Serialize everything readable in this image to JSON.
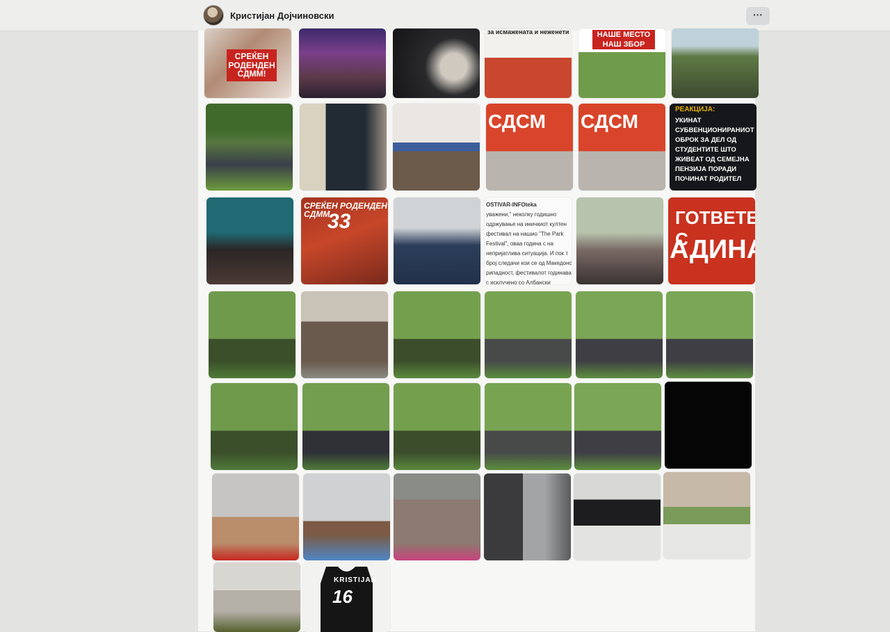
{
  "header": {
    "profile_name": "Кристијан Дојчиновски",
    "more_label": "···"
  },
  "overlays": {
    "birthday": "СРЕЌЕН РОДЕНДЕН СДММ!",
    "headline_top": "за исмажената и неженети",
    "nashe_mesto": "НАШЕ МЕСТО НАШ ЗБОР",
    "reaction_title": "РЕАКЦИЈА:",
    "reaction_text": "УКИНАТ СУБВЕНЦИОНИРАНИОТ ОБРОК ЗА ДЕЛ ОД СТУДЕНТИТЕ ШТО ЖИВЕАТ ОД СЕМЕЈНА ПЕНЗИЈА ПОРАДИ ПОЧИНАТ РОДИТЕЛ",
    "sdsm_wall": "СДСМ",
    "birthday33_a": "СРЕЌЕН РОДЕНДЕН СДММ",
    "birthday33_num": "33",
    "post_source": "OSTIVAR-INFOteka",
    "post_text": "уважени,\" неколку годишно одржување на иничкиот култен фестивал на нашио \"The Park Festival\", оваа година с на непријатлива ситуација. И пок т број следачи кои се од Македонс рипадност, фестивалот годинава с исклучено со Албански изведувач",
    "gotovete": "ГОТВЕТЕ С",
    "nadina": "АДИНА",
    "jersey_name": "KRISTIJAN",
    "jersey_number": "16"
  }
}
